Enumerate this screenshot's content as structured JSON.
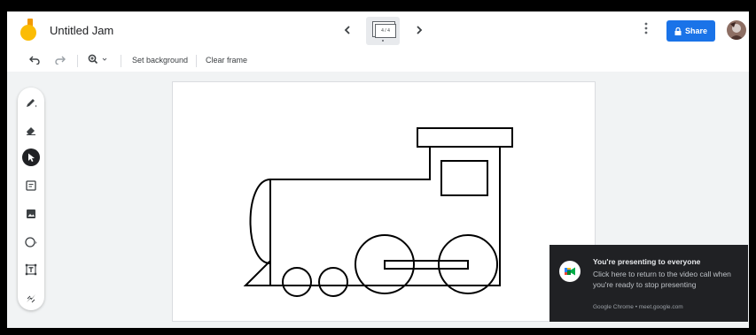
{
  "app": {
    "title": "Untitled Jam",
    "share_label": "Share"
  },
  "frame_nav": {
    "indicator": "4 / 4"
  },
  "toolbar": {
    "set_background": "Set background",
    "clear_frame": "Clear frame"
  },
  "tools": [
    {
      "name": "pen"
    },
    {
      "name": "eraser"
    },
    {
      "name": "select",
      "active": true
    },
    {
      "name": "sticky-note"
    },
    {
      "name": "image"
    },
    {
      "name": "circle"
    },
    {
      "name": "text-box"
    },
    {
      "name": "laser"
    }
  ],
  "toast": {
    "title": "You're presenting to everyone",
    "body": "Click here to return to the video call when you're ready to stop presenting",
    "source": "Google Chrome • meet.google.com"
  },
  "colors": {
    "accent": "#1a73e8",
    "toast_bg": "#202124",
    "logo_yellow": "#fbbc04",
    "logo_orange": "#f29900"
  }
}
